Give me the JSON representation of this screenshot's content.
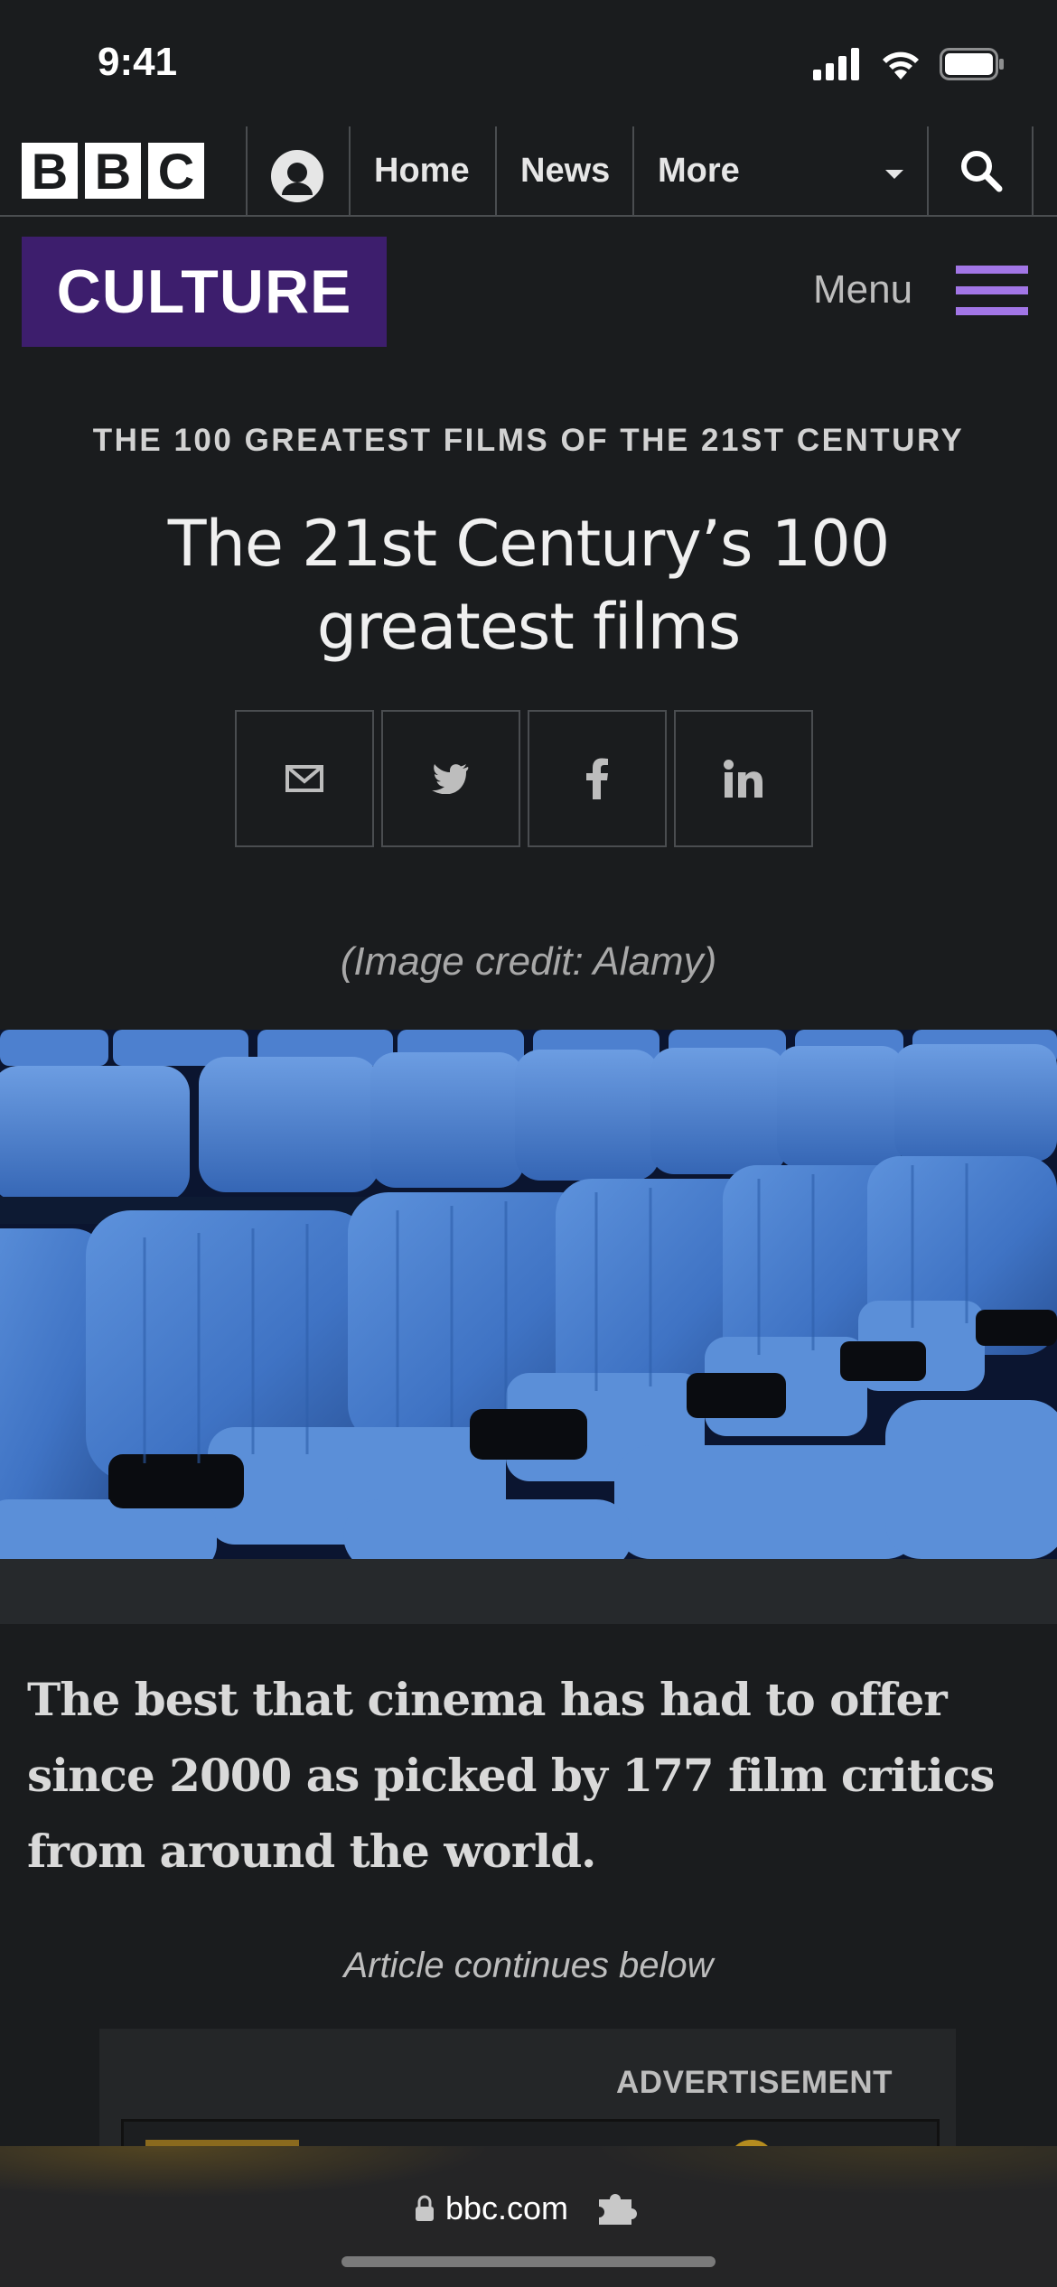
{
  "status_bar": {
    "time": "9:41"
  },
  "nav": {
    "logo_letters": [
      "B",
      "B",
      "C"
    ],
    "links": [
      "Home",
      "News",
      "More"
    ]
  },
  "section": {
    "name": "CULTURE",
    "menu_label": "Menu",
    "accent_color": "#3d1e6d",
    "menu_icon_color": "#a276e6"
  },
  "article": {
    "kicker": "THE 100 GREATEST FILMS OF THE 21ST CENTURY",
    "headline": "The 21st Century’s 100 greatest films",
    "share_buttons": [
      "email-icon",
      "twitter-icon",
      "facebook-icon",
      "linkedin-icon"
    ],
    "image_credit": "(Image credit: Alamy)",
    "standfirst": "The best that cinema has had to offer since 2000 as picked by 177 film critics from around the world.",
    "continues": "Article continues below"
  },
  "ad": {
    "label": "ADVERTISEMENT"
  },
  "browser": {
    "url": "bbc.com"
  }
}
